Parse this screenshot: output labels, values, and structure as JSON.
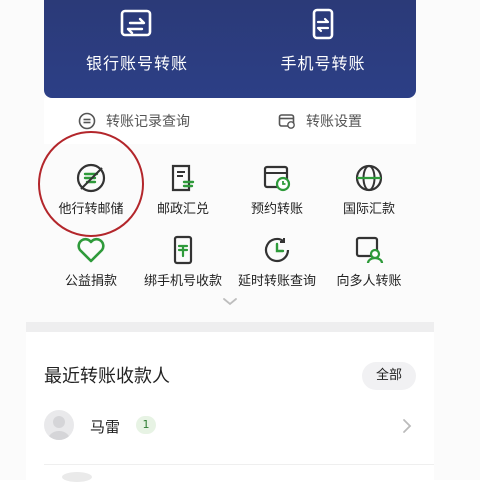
{
  "top_actions": [
    {
      "label": "银行账号转账",
      "icon": "bank-card-transfer-icon"
    },
    {
      "label": "手机号转账",
      "icon": "phone-transfer-icon"
    }
  ],
  "sub_actions": [
    {
      "label": "转账记录查询",
      "icon": "record-list-icon"
    },
    {
      "label": "转账设置",
      "icon": "settings-card-icon"
    }
  ],
  "grid": [
    {
      "label": "他行转邮储",
      "icon": "bank-to-postal-icon"
    },
    {
      "label": "邮政汇兑",
      "icon": "postal-remit-icon"
    },
    {
      "label": "预约转账",
      "icon": "scheduled-transfer-icon"
    },
    {
      "label": "国际汇款",
      "icon": "globe-icon"
    },
    {
      "label": "公益捐款",
      "icon": "charity-heart-icon"
    },
    {
      "label": "绑手机号收款",
      "icon": "phone-bind-icon"
    },
    {
      "label": "延时转账查询",
      "icon": "delay-clock-icon"
    },
    {
      "label": "向多人转账",
      "icon": "multi-transfer-icon"
    }
  ],
  "recent": {
    "title": "最近转账收款人",
    "all_label": "全部",
    "payees": [
      {
        "name": "马雷",
        "badge": "1"
      }
    ]
  },
  "colors": {
    "top_card": "#2c3f86",
    "accent_green": "#2e7d32",
    "highlight_red": "#b3262b",
    "icon_dark": "#333333"
  }
}
